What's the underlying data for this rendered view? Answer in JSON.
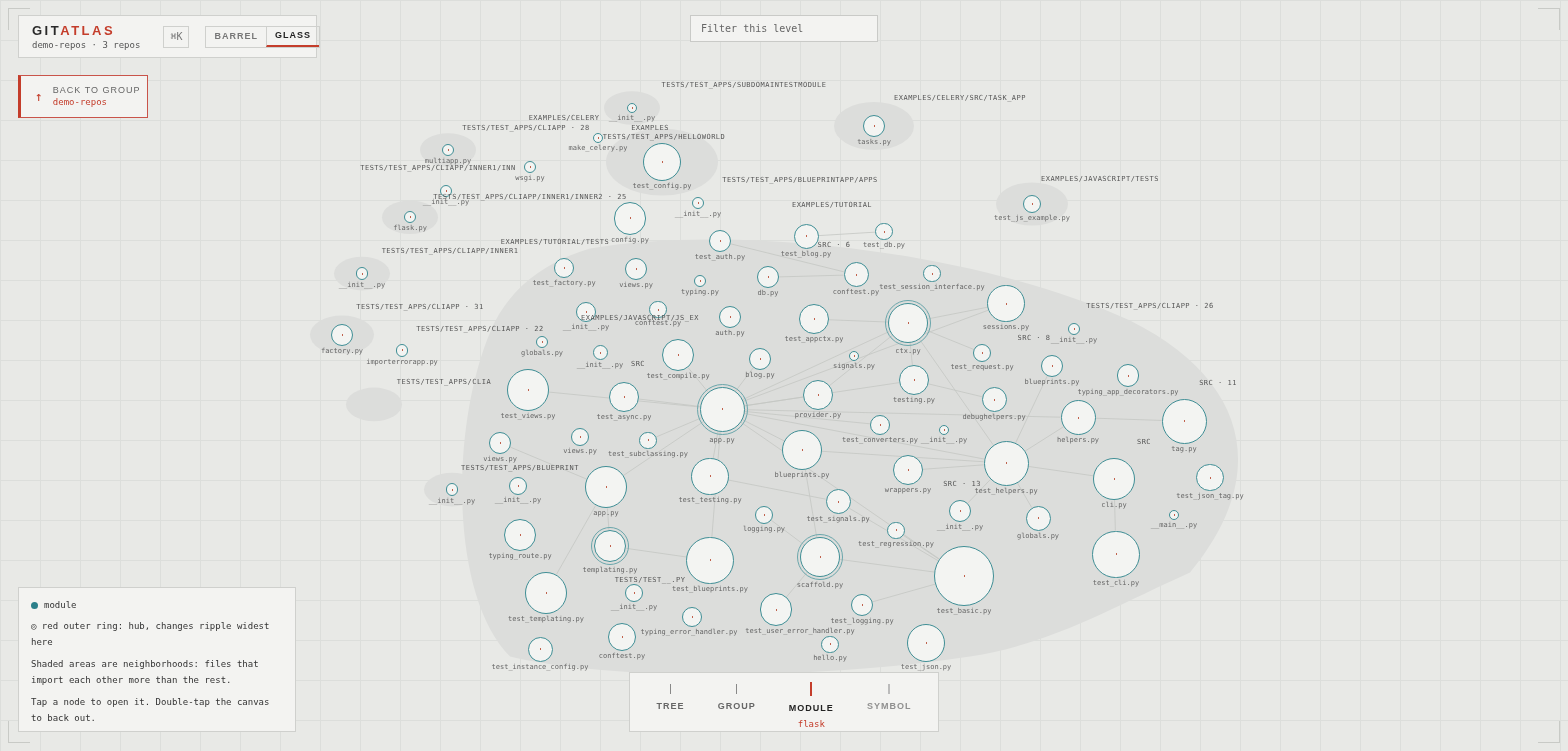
{
  "header": {
    "brand": [
      {
        "text": "GIT",
        "accent": false
      },
      {
        "text": "ATLAS",
        "accent": true
      }
    ],
    "subtitle": "demo-repos · 3 repos",
    "shortcut": "⌘K",
    "modes": [
      {
        "label": "BARREL",
        "selected": false
      },
      {
        "label": "GLASS",
        "selected": true
      }
    ]
  },
  "back": {
    "icon": "↑",
    "label": "BACK TO GROUP",
    "target": "demo-repos"
  },
  "filter": {
    "placeholder": "Filter this level"
  },
  "groups": [
    "TESTS/TEST_APPS/SUBDOMAINTESTMODULE",
    "EXAMPLES/CELERY",
    "EXAMPLES/CELERY/SRC/TASK_APP",
    "TESTS/TEST_APPS/CLIAPP · 28",
    "EXAMPLES",
    "TESTS/TEST_APPS/HELLOWORLD",
    "TESTS/TEST_APPS/CLIAPP/INNER1/INN",
    "TESTS/TEST_APPS/BLUEPRINTAPP/APPS",
    "EXAMPLES/JAVASCRIPT/TESTS",
    "TESTS/TEST_APPS/CLIAPP/INNER1/INNER2 · 25",
    "EXAMPLES/TUTORIAL",
    "EXAMPLES/TUTORIAL/TESTS",
    "SRC · 6",
    "TESTS/TEST_APPS/CLIAPP/INNER1",
    "TESTS/TEST_APPS/CLIAPP · 31",
    "EXAMPLES/JAVASCRIPT/JS_EX",
    "TESTS/TEST_APPS/CLIAPP · 22",
    "TESTS/TEST_APPS/CLIAPP · 26",
    "SRC · 8",
    "SRC",
    "TESTS/TEST_APPS/CLIA",
    "SRC · 11",
    "SRC",
    "TESTS/TEST_APPS/BLUEPRINT",
    "SRC · 13",
    "TESTS/TEST__.PY"
  ],
  "nodes": [
    {
      "label": "__init__.py",
      "ring": false
    },
    {
      "label": "tasks.py",
      "ring": false
    },
    {
      "label": "multiapp.py",
      "ring": false
    },
    {
      "label": "make_celery.py",
      "ring": false
    },
    {
      "label": "test_config.py",
      "ring": false
    },
    {
      "label": "wsgi.py",
      "ring": false
    },
    {
      "label": "__init__.py",
      "ring": false
    },
    {
      "label": "__init__.py",
      "ring": false
    },
    {
      "label": "flask.py",
      "ring": false
    },
    {
      "label": "test_js_example.py",
      "ring": false
    },
    {
      "label": "config.py",
      "ring": false
    },
    {
      "label": "test_blog.py",
      "ring": false
    },
    {
      "label": "test_db.py",
      "ring": false
    },
    {
      "label": "test_auth.py",
      "ring": false
    },
    {
      "label": "__init__.py",
      "ring": false
    },
    {
      "label": "test_factory.py",
      "ring": false
    },
    {
      "label": "views.py",
      "ring": false
    },
    {
      "label": "typing.py",
      "ring": false
    },
    {
      "label": "db.py",
      "ring": false
    },
    {
      "label": "conftest.py",
      "ring": false
    },
    {
      "label": "test_session_interface.py",
      "ring": false
    },
    {
      "label": "sessions.py",
      "ring": false
    },
    {
      "label": "__init__.py",
      "ring": false
    },
    {
      "label": "ctx.py",
      "ring": true
    },
    {
      "label": "test_appctx.py",
      "ring": false
    },
    {
      "label": "auth.py",
      "ring": false
    },
    {
      "label": "conftest.py",
      "ring": false
    },
    {
      "label": "__init__.py",
      "ring": false
    },
    {
      "label": "factory.py",
      "ring": false
    },
    {
      "label": "importerrorapp.py",
      "ring": false
    },
    {
      "label": "globals.py",
      "ring": false
    },
    {
      "label": "__init__.py",
      "ring": false
    },
    {
      "label": "test_compile.py",
      "ring": false
    },
    {
      "label": "blog.py",
      "ring": false
    },
    {
      "label": "signals.py",
      "ring": false
    },
    {
      "label": "test_request.py",
      "ring": false
    },
    {
      "label": "blueprints.py",
      "ring": false
    },
    {
      "label": "typing_app_decorators.py",
      "ring": false
    },
    {
      "label": "test_views.py",
      "ring": false
    },
    {
      "label": "test_async.py",
      "ring": false
    },
    {
      "label": "app.py",
      "ring": true
    },
    {
      "label": "provider.py",
      "ring": false
    },
    {
      "label": "testing.py",
      "ring": false
    },
    {
      "label": "debughelpers.py",
      "ring": false
    },
    {
      "label": "helpers.py",
      "ring": false
    },
    {
      "label": "tag.py",
      "ring": false
    },
    {
      "label": "test_converters.py",
      "ring": false
    },
    {
      "label": "__init__.py",
      "ring": false
    },
    {
      "label": "views.py",
      "ring": false
    },
    {
      "label": "views.py",
      "ring": false
    },
    {
      "label": "test_subclassing.py",
      "ring": false
    },
    {
      "label": "blueprints.py",
      "ring": false
    },
    {
      "label": "wrappers.py",
      "ring": false
    },
    {
      "label": "test_helpers.py",
      "ring": false
    },
    {
      "label": "cli.py",
      "ring": false
    },
    {
      "label": "test_json_tag.py",
      "ring": false
    },
    {
      "label": "__init__.py",
      "ring": false
    },
    {
      "label": "__init__.py",
      "ring": false
    },
    {
      "label": "app.py",
      "ring": false
    },
    {
      "label": "test_testing.py",
      "ring": false
    },
    {
      "label": "test_signals.py",
      "ring": false
    },
    {
      "label": "logging.py",
      "ring": false
    },
    {
      "label": "__init__.py",
      "ring": false
    },
    {
      "label": "globals.py",
      "ring": false
    },
    {
      "label": "__main__.py",
      "ring": false
    },
    {
      "label": "test_regression.py",
      "ring": false
    },
    {
      "label": "typing_route.py",
      "ring": false
    },
    {
      "label": "templating.py",
      "ring": true
    },
    {
      "label": "test_blueprints.py",
      "ring": false
    },
    {
      "label": "scaffold.py",
      "ring": true
    },
    {
      "label": "test_basic.py",
      "ring": false
    },
    {
      "label": "test_cli.py",
      "ring": false
    },
    {
      "label": "test_templating.py",
      "ring": false
    },
    {
      "label": "__init__.py",
      "ring": false
    },
    {
      "label": "typing_error_handler.py",
      "ring": false
    },
    {
      "label": "test_user_error_handler.py",
      "ring": false
    },
    {
      "label": "test_logging.py",
      "ring": false
    },
    {
      "label": "conftest.py",
      "ring": false
    },
    {
      "label": "test_instance_config.py",
      "ring": false
    },
    {
      "label": "hello.py",
      "ring": false
    },
    {
      "label": "test_json.py",
      "ring": false
    }
  ],
  "legend": {
    "items": [
      {
        "kind": "dot",
        "color": "#2b7f8a",
        "text": "module"
      },
      {
        "kind": "text",
        "text": "◎ red outer ring: hub, changes ripple widest here"
      },
      {
        "kind": "text",
        "text": "Shaded areas are neighborhoods: files that import each other more than the rest."
      },
      {
        "kind": "text",
        "text": "Tap a node to open it. Double-tap the canvas to back out."
      }
    ]
  },
  "levels": {
    "items": [
      {
        "label": "TREE",
        "selected": false,
        "disabled": false
      },
      {
        "label": "GROUP",
        "selected": false,
        "disabled": false
      },
      {
        "label": "MODULE",
        "selected": true,
        "disabled": false
      },
      {
        "label": "SYMBOL",
        "selected": false,
        "disabled": true
      }
    ],
    "current": "flask"
  }
}
